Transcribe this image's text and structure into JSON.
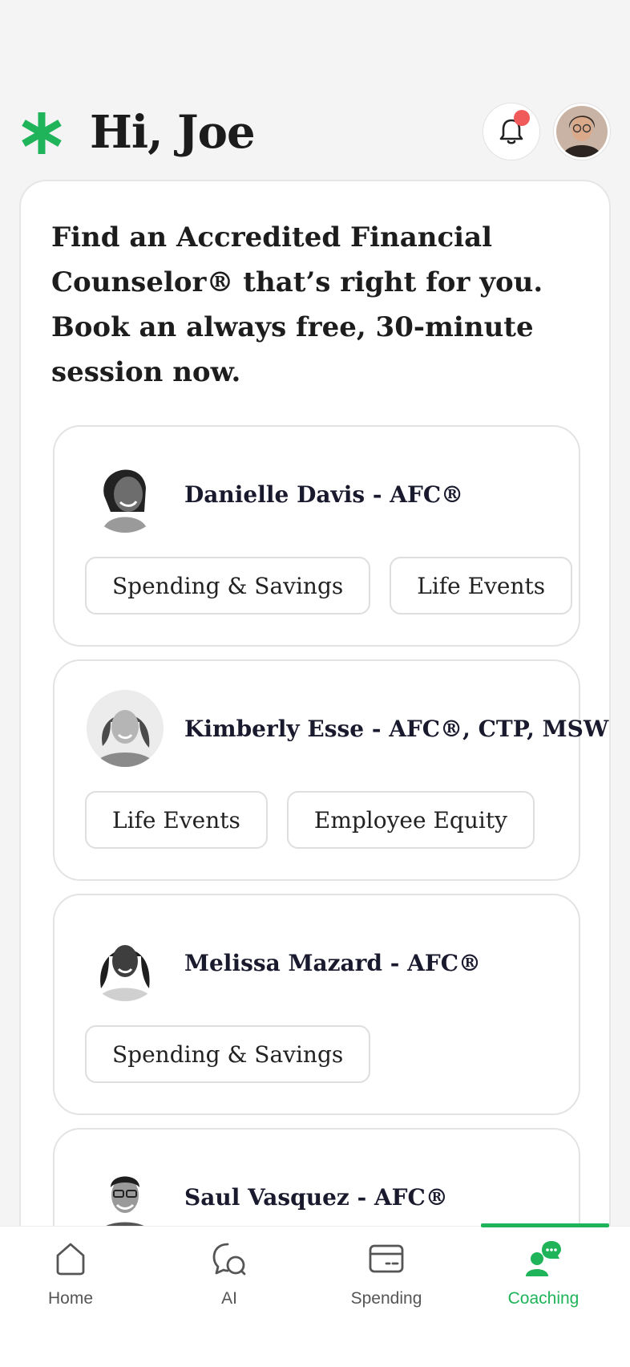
{
  "header": {
    "greeting": "Hi, Joe",
    "logo_icon": "asterisk-logo-icon",
    "notification_icon": "bell-icon",
    "notification_dot_color": "#f05a5a",
    "brand_color": "#1fb35a"
  },
  "intro": {
    "text": "Find an Accredited Financial Counselor® that’s right for you. Book an always free, 30-minute session now."
  },
  "coaches": [
    {
      "name": "Danielle Davis - AFC®",
      "tags": [
        "Spending & Savings",
        "Life Events"
      ]
    },
    {
      "name": "Kimberly Esse - AFC®, CTP, MSW",
      "tags": [
        "Life Events",
        "Employee Equity"
      ]
    },
    {
      "name": "Melissa Mazard - AFC®",
      "tags": [
        "Spending & Savings"
      ]
    },
    {
      "name": "Saul Vasquez - AFC®",
      "tags": []
    }
  ],
  "nav": {
    "items": [
      {
        "label": "Home",
        "icon": "home-icon"
      },
      {
        "label": "AI",
        "icon": "chat-bubble-icon"
      },
      {
        "label": "Spending",
        "icon": "card-icon"
      },
      {
        "label": "Coaching",
        "icon": "coaching-icon"
      }
    ],
    "active": "Coaching"
  }
}
